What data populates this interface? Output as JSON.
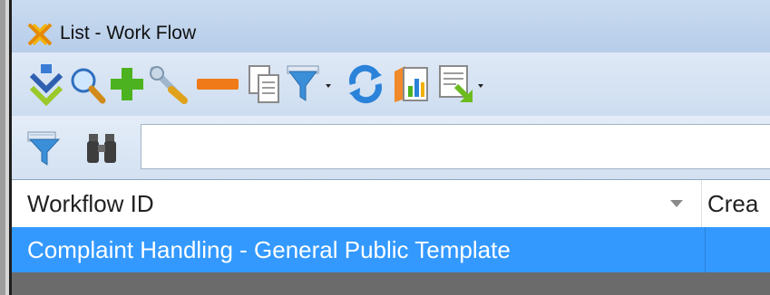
{
  "window": {
    "title": "List - Work Flow",
    "logo_icon": "workflow-logo-icon"
  },
  "toolbar": {
    "buttons": [
      {
        "name": "download-icon"
      },
      {
        "name": "search-icon"
      },
      {
        "name": "add-icon"
      },
      {
        "name": "wrench-icon"
      },
      {
        "name": "remove-icon"
      },
      {
        "name": "copy-icon"
      },
      {
        "name": "filter-dropdown-icon"
      },
      {
        "name": "refresh-icon"
      },
      {
        "name": "report-icon"
      },
      {
        "name": "export-dropdown-icon"
      }
    ]
  },
  "filterbar": {
    "filter_icon": "filter-icon",
    "find_icon": "binoculars-icon",
    "search_value": ""
  },
  "grid": {
    "columns": [
      "Workflow ID",
      "Crea"
    ],
    "rows": [
      {
        "workflow_id": "Complaint Handling - General Public Template",
        "created": ""
      }
    ]
  },
  "colors": {
    "selection": "#3399ff",
    "titlebar": "#c9dbf0",
    "toolbar": "#dfe9f6"
  }
}
